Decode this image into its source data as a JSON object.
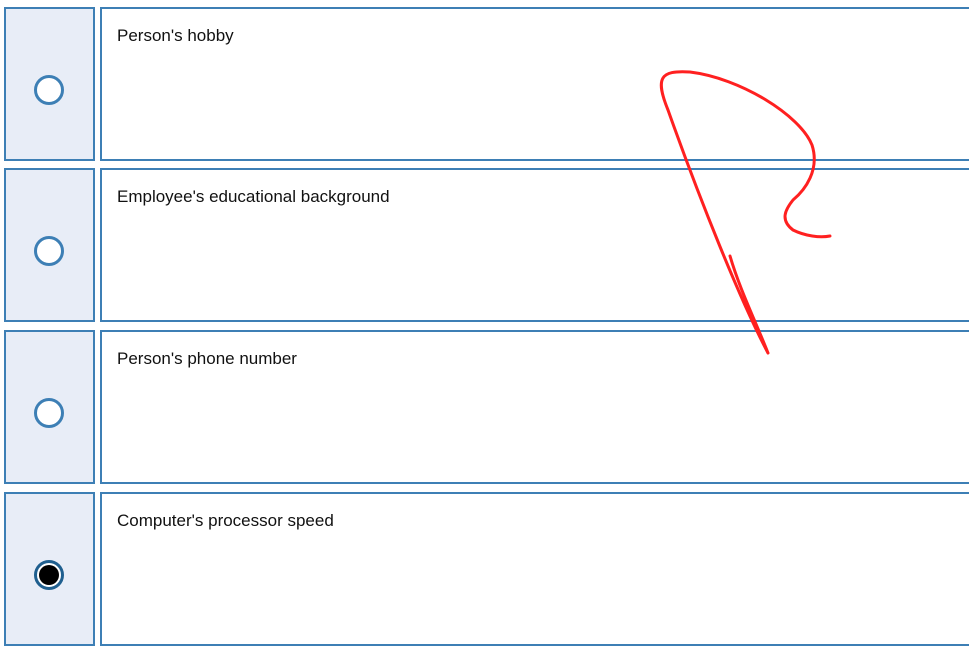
{
  "options": [
    {
      "label": "Person's hobby",
      "selected": false
    },
    {
      "label": "Employee's educational background",
      "selected": false
    },
    {
      "label": "Person's phone number",
      "selected": false
    },
    {
      "label": "Computer's processor speed",
      "selected": true
    }
  ],
  "colors": {
    "border": "#3d7fb5",
    "radio_cell_bg": "#e8edf7",
    "annotation": "#ff2020"
  }
}
